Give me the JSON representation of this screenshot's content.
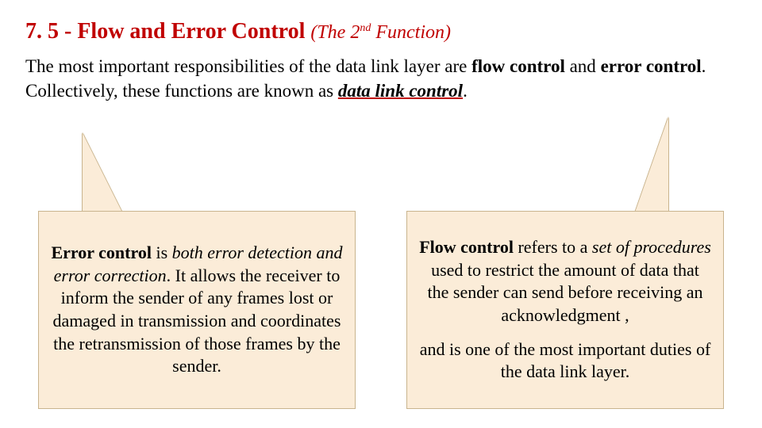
{
  "title": {
    "number": "7. 5 -",
    "text": "Flow and Error Control",
    "sub_pre": "(The 2",
    "sub_sup": "nd",
    "sub_post": " Function)"
  },
  "intro": {
    "t1": "The most important responsibilities of the data link layer are ",
    "b1": "flow control",
    "t2": " and ",
    "b2": "error control",
    "t3": ". Collectively, these functions are known as ",
    "em": "data link control",
    "t4": "."
  },
  "error": {
    "b1": "Error control",
    "t1": " is ",
    "i1": "both error detection and error correction",
    "t2": ". It allows the receiver to inform the sender of any frames lost or damaged in transmission and coordinates the retransmission of those frames by the sender."
  },
  "flow": {
    "p1": {
      "b1": "Flow control",
      "t1": " refers to a ",
      "i1": "set of procedures",
      "t2": " used to restrict the amount of data that the sender can send before receiving an acknowledgment ,"
    },
    "p2": "and is one of the most important duties of the data link layer."
  }
}
